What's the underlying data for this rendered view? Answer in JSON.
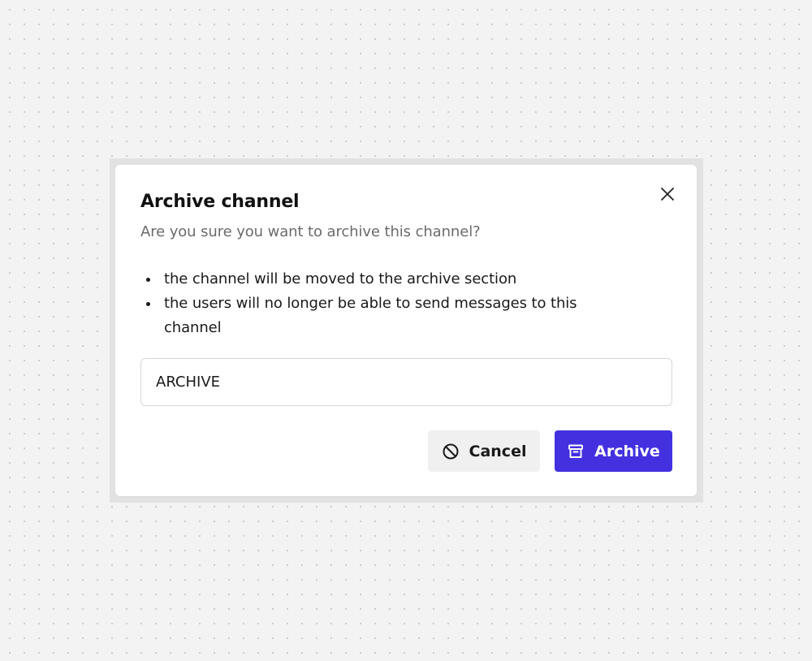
{
  "dialog": {
    "title": "Archive channel",
    "subtitle": "Are you sure you want to archive this channel?",
    "bullets": [
      "the channel will be moved to the archive section",
      "the users will no longer be able to send messages to this channel"
    ],
    "confirm_input": {
      "value": "ARCHIVE",
      "placeholder": ""
    },
    "close_icon": "close-icon",
    "cancel_button": {
      "label": "Cancel",
      "icon": "ban-icon"
    },
    "archive_button": {
      "label": "Archive",
      "icon": "archive-box-icon"
    }
  },
  "colors": {
    "primary": "#4331e0",
    "background": "#f3f3f3",
    "text": "#1a1a1a",
    "muted_text": "#6b6b6b",
    "cancel_bg": "#f0f0f0"
  }
}
